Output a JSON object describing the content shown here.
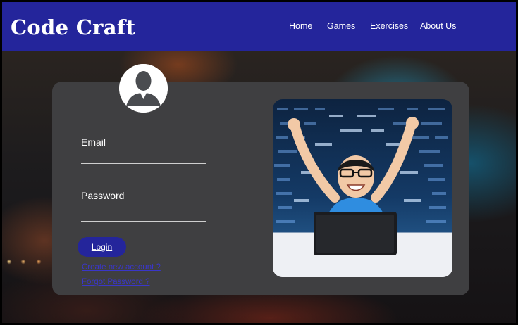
{
  "header": {
    "brand": "Code Craft",
    "nav": [
      {
        "label": "Home"
      },
      {
        "label": "Games"
      },
      {
        "label": "Exercises"
      },
      {
        "label": "About Us"
      }
    ]
  },
  "login": {
    "email_label": "Email",
    "password_label": "Password",
    "login_button": "Login",
    "create_account": "Create new account ?",
    "forgot_password": "Forgot Password ?"
  },
  "photo": {
    "icon": "child-celebrating-laptop-image"
  },
  "avatar": {
    "icon": "user-avatar-icon"
  },
  "colors": {
    "nav_bg": "#24259b",
    "card_bg": "#3f3f41",
    "link": "#3a36c9"
  }
}
